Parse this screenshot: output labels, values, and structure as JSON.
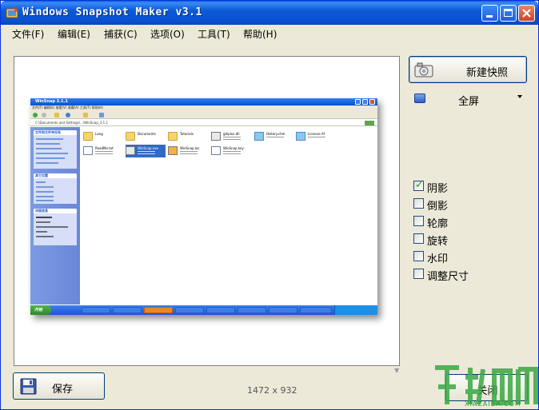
{
  "window": {
    "title": "Windows Snapshot Maker v3.1"
  },
  "menu": [
    "文件(F)",
    "编辑(E)",
    "捕获(C)",
    "选项(O)",
    "工具(T)",
    "帮助(H)"
  ],
  "preview_shot": {
    "window_title": "WinSnap 3.1.1",
    "menu_text": "文件(F)  编辑(E)  查看(V)  收藏(A)  工具(T)  帮助(H)",
    "address": "C:\\Documents and Settings\\...\\WinSnap_3.1.1",
    "sidebar_panels": [
      "文件和文件夹任务",
      "其它位置",
      "详细信息"
    ],
    "files": [
      "Lang",
      "Documents",
      "Tutorials",
      "gdiplus.dll",
      "History.chm",
      "License.rtf",
      "ReadMe.txt",
      "WinSnap.exe",
      "WinSnap.loc",
      "WinSnap.key"
    ],
    "start_label": "开始"
  },
  "actions": {
    "new_snapshot": "新建快照",
    "save": "保存",
    "close": "关闭"
  },
  "mode": {
    "selected": "全屏"
  },
  "options": [
    {
      "label": "阴影",
      "checked": true
    },
    {
      "label": "倒影",
      "checked": false
    },
    {
      "label": "轮廓",
      "checked": false
    },
    {
      "label": "旋转",
      "checked": false
    },
    {
      "label": "水印",
      "checked": false
    },
    {
      "label": "调整尺寸",
      "checked": false
    }
  ],
  "status": {
    "dimensions": "1472 x 932"
  },
  "watermark": {
    "text": "XIAZAIBA.COM"
  },
  "colors": {
    "titlebar": "#0750d0",
    "window_bg": "#ece9d8",
    "check_mark": "#21a121",
    "watermark": "#2e9a3a"
  }
}
